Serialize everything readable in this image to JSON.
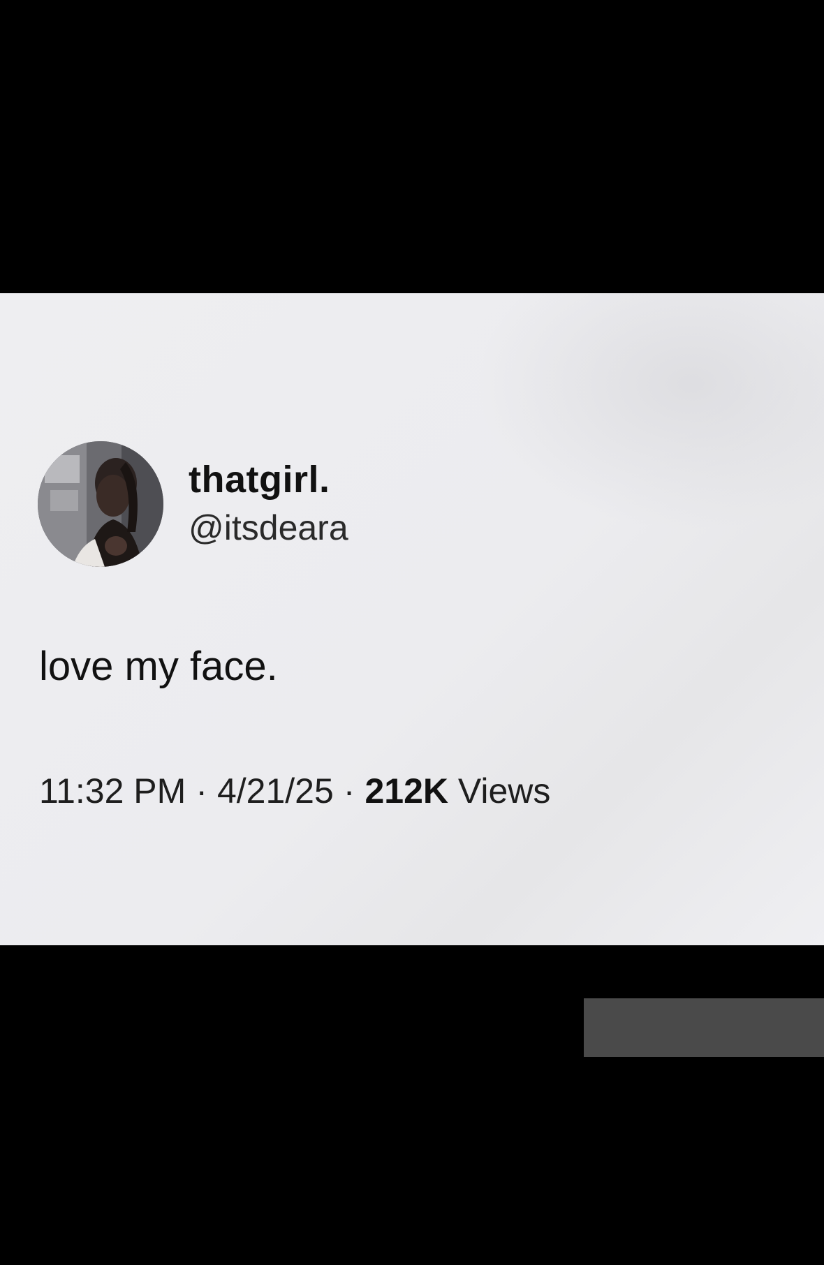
{
  "tweet": {
    "display_name": "thatgirl.",
    "handle": "@itsdeara",
    "text": "love my face.",
    "time": "11:32 PM",
    "date": "4/21/25",
    "separator": "·",
    "views_count": "212K",
    "views_label": "Views"
  },
  "colors": {
    "background": "#000000",
    "card": "#eeeef1",
    "text": "#111111"
  }
}
